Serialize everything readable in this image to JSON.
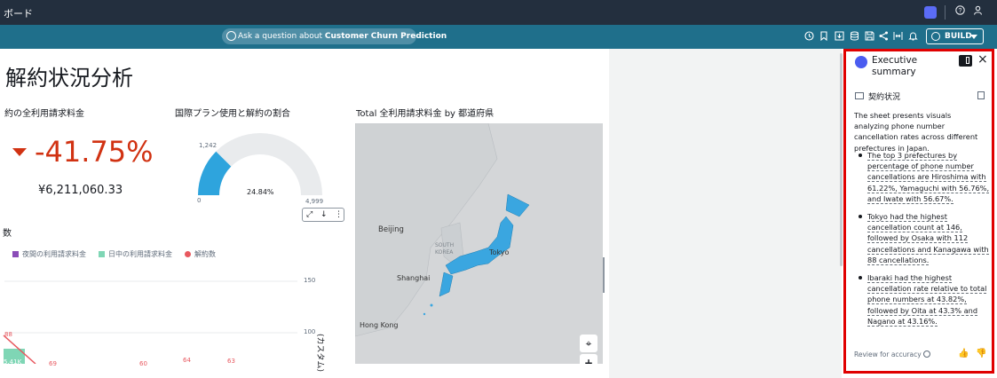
{
  "topbar": {
    "breadcrumb": "ボード",
    "help_icon": "?",
    "user_icon": "person-icon"
  },
  "toolbar": {
    "ask_prefix": "Ask a question about ",
    "ask_topic": "Customer Churn Prediction",
    "build_label": "BUILD"
  },
  "sheet": {
    "title": "解約状況分析"
  },
  "kpi": {
    "title": "約の全利用請求料金",
    "value": "-41.75%",
    "subvalue": "¥6,211,060.33"
  },
  "gauge": {
    "title": "国際プラン使用と解約の割合",
    "value_label": "1,242",
    "min_label": "0",
    "max_label": "4,999",
    "percent_label": "24.84%",
    "percent": 24.84
  },
  "combo": {
    "title_fragment": "数",
    "legend": [
      {
        "label": "夜間の利用請求料金",
        "color": "#8b4db8"
      },
      {
        "label": "日中の利用請求料金",
        "color": "#7fd6b5"
      },
      {
        "label": "解約数",
        "color": "#e8585f"
      }
    ],
    "axis_right_ticks": [
      "150",
      "100"
    ],
    "y_axis_label": "(カスタム)",
    "data_labels": [
      "88",
      "64",
      "63",
      "69",
      "60"
    ],
    "bar_label": "5.41K"
  },
  "map": {
    "title": "Total 全利用請求料金 by 都道府県",
    "labels": [
      "Beijing",
      "SOUTH KOREA",
      "Tokyo",
      "Shanghai",
      "Hong Kong"
    ]
  },
  "summary": {
    "header": "Executive summary",
    "section": "契約状況",
    "intro": "The sheet presents visuals analyzing phone number cancellation rates across different prefectures in Japan.",
    "bullets": [
      "The top 3 prefectures by percentage of phone number cancellations are Hiroshima with 61.22%, Yamaguchi with 56.76%, and Iwate with 56.67%.",
      "Tokyo had the highest cancellation count at 146, followed by Osaka with 112 cancellations and Kanagawa with 88 cancellations.",
      "Ibaraki had the highest cancellation rate relative to total phone numbers at 43.82%, followed by Oita at 43.3% and Nagano at 43.16%."
    ],
    "footer": "Review for accuracy"
  },
  "colors": {
    "kpi_red": "#d13212",
    "gauge_blue": "#2ea4dd",
    "panel_border": "#e00000",
    "toolbar": "#1f6f8b"
  }
}
